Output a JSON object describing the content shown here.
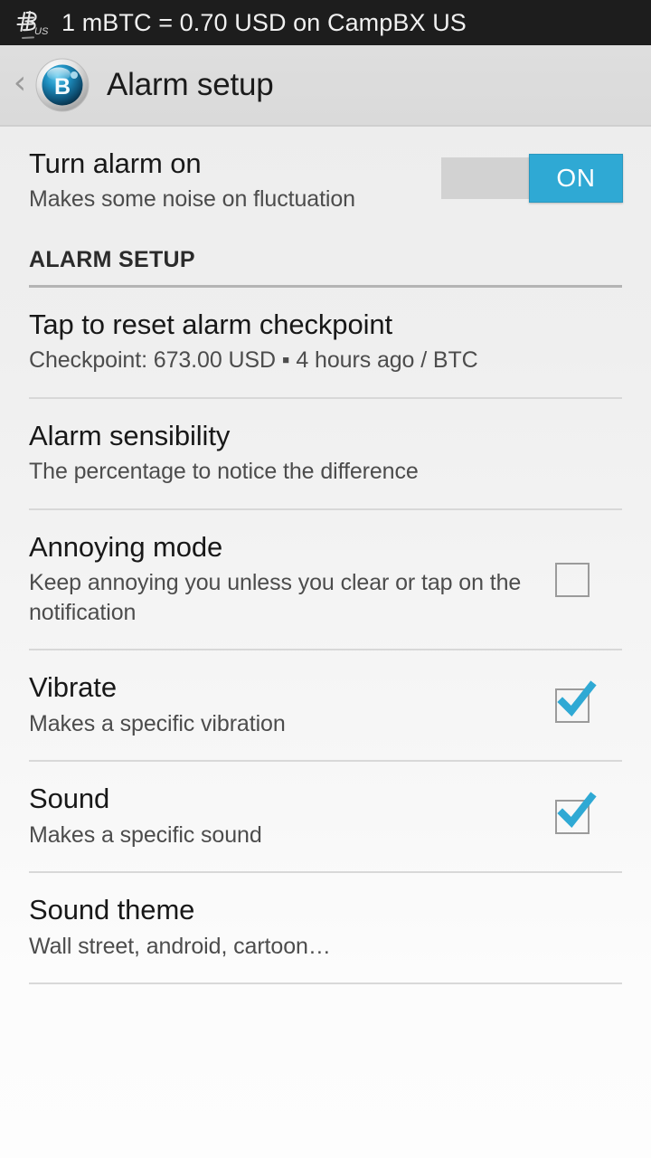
{
  "status_bar": {
    "icon": "bitcoin-b-us-icon",
    "ticker_text": "1 mBTC = 0.70 USD on CampBX US"
  },
  "action_bar": {
    "back_icon": "back-chevron-icon",
    "app_icon": "bitcoin-sphere-icon",
    "title": "Alarm setup"
  },
  "colors": {
    "accent": "#2fa9d4",
    "status_bar_bg": "#1d1d1d",
    "action_bar_bg": "#dcdcdc",
    "page_bg_top": "#ececec",
    "page_bg_bottom": "#fdfdfd",
    "divider": "#d8d8d8",
    "section_rule": "#b4b4b4"
  },
  "preferences": {
    "alarm_toggle": {
      "title": "Turn alarm on",
      "summary": "Makes some noise on fluctuation",
      "switch_state_label": "ON",
      "checked": true
    },
    "section": {
      "title": "ALARM SETUP"
    },
    "items": [
      {
        "name": "reset-checkpoint",
        "title": "Tap to reset alarm checkpoint",
        "summary": "Checkpoint: 673.00 USD ▪ 4 hours ago / BTC",
        "widget": "none"
      },
      {
        "name": "alarm-sensibility",
        "title": "Alarm sensibility",
        "summary": "The percentage to notice the difference",
        "widget": "none"
      },
      {
        "name": "annoying-mode",
        "title": "Annoying mode",
        "summary": "Keep annoying you unless you clear or tap on the notification",
        "widget": "checkbox",
        "checked": false
      },
      {
        "name": "vibrate",
        "title": "Vibrate",
        "summary": "Makes a specific vibration",
        "widget": "checkbox",
        "checked": true
      },
      {
        "name": "sound",
        "title": "Sound",
        "summary": "Makes a specific sound",
        "widget": "checkbox",
        "checked": true
      },
      {
        "name": "sound-theme",
        "title": "Sound theme",
        "summary": "Wall street, android, cartoon…",
        "widget": "none"
      }
    ]
  }
}
